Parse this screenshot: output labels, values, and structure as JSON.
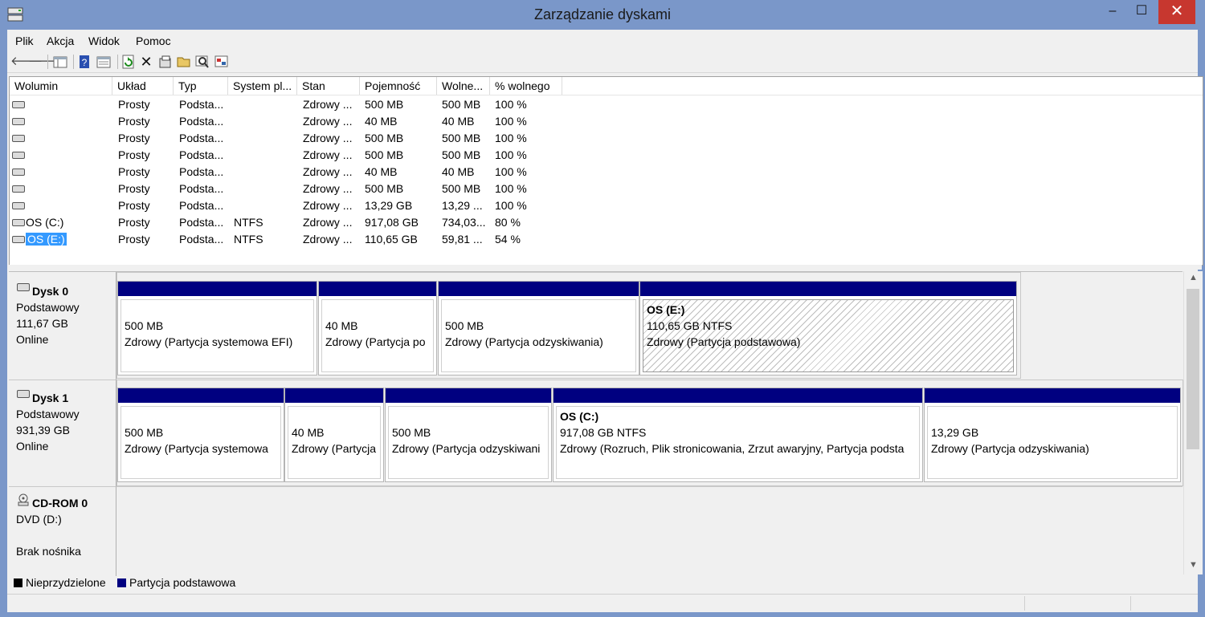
{
  "window": {
    "title": "Zarządzanie dyskami",
    "close_glyph": "✕",
    "max_glyph": "☐",
    "min_glyph": "–"
  },
  "menu": [
    "Plik",
    "Akcja",
    "Widok",
    "Pomoc"
  ],
  "toolbar": [
    "back-icon",
    "forward-icon",
    "console-tree-icon",
    "help-icon",
    "properties-icon",
    "refresh-icon",
    "delete-icon",
    "edit-icon",
    "open-icon",
    "search-icon",
    "settings-icon"
  ],
  "volume_table": {
    "columns": [
      "Wolumin",
      "Układ",
      "Typ",
      "System pl...",
      "Stan",
      "Pojemność",
      "Wolne...",
      "% wolnego"
    ],
    "rows": [
      [
        "",
        "Prosty",
        "Podsta...",
        "",
        "Zdrowy ...",
        "500 MB",
        "500 MB",
        "100 %"
      ],
      [
        "",
        "Prosty",
        "Podsta...",
        "",
        "Zdrowy ...",
        "40 MB",
        "40 MB",
        "100 %"
      ],
      [
        "",
        "Prosty",
        "Podsta...",
        "",
        "Zdrowy ...",
        "500 MB",
        "500 MB",
        "100 %"
      ],
      [
        "",
        "Prosty",
        "Podsta...",
        "",
        "Zdrowy ...",
        "500 MB",
        "500 MB",
        "100 %"
      ],
      [
        "",
        "Prosty",
        "Podsta...",
        "",
        "Zdrowy ...",
        "40 MB",
        "40 MB",
        "100 %"
      ],
      [
        "",
        "Prosty",
        "Podsta...",
        "",
        "Zdrowy ...",
        "500 MB",
        "500 MB",
        "100 %"
      ],
      [
        "",
        "Prosty",
        "Podsta...",
        "",
        "Zdrowy ...",
        "13,29 GB",
        "13,29 ...",
        "100 %"
      ],
      [
        "OS (C:)",
        "Prosty",
        "Podsta...",
        "NTFS",
        "Zdrowy ...",
        "917,08 GB",
        "734,03...",
        "80 %"
      ],
      [
        "OS (E:)",
        "Prosty",
        "Podsta...",
        "NTFS",
        "Zdrowy ...",
        "110,65 GB",
        "59,81 ...",
        "54 %"
      ]
    ],
    "selected_row": 8
  },
  "disks": [
    {
      "name": "Dysk 0",
      "type": "Podstawowy",
      "size": "111,67 GB",
      "status": "Online",
      "partitions": [
        {
          "label": "",
          "size": "500 MB",
          "status": "Zdrowy (Partycja systemowa EFI)"
        },
        {
          "label": "",
          "size": "40 MB",
          "status": "Zdrowy (Partycja po"
        },
        {
          "label": "",
          "size": "500 MB",
          "status": "Zdrowy (Partycja odzyskiwania)"
        },
        {
          "label": "OS  (E:)",
          "size": "110,65 GB NTFS",
          "status": "Zdrowy (Partycja podstawowa)"
        }
      ]
    },
    {
      "name": "Dysk 1",
      "type": "Podstawowy",
      "size": "931,39 GB",
      "status": "Online",
      "partitions": [
        {
          "label": "",
          "size": "500 MB",
          "status": "Zdrowy (Partycja systemowa"
        },
        {
          "label": "",
          "size": "40 MB",
          "status": "Zdrowy (Partycja"
        },
        {
          "label": "",
          "size": "500 MB",
          "status": "Zdrowy (Partycja odzyskiwani"
        },
        {
          "label": "OS  (C:)",
          "size": "917,08 GB NTFS",
          "status": "Zdrowy (Rozruch, Plik stronicowania, Zrzut awaryjny, Partycja podsta"
        },
        {
          "label": "",
          "size": "13,29 GB",
          "status": "Zdrowy (Partycja odzyskiwania)"
        }
      ]
    }
  ],
  "cdrom": {
    "name": "CD-ROM 0",
    "drive": "DVD (D:)",
    "media": "Brak nośnika"
  },
  "legend": [
    {
      "label": "Nieprzydzielone",
      "color": "#000000"
    },
    {
      "label": "Partycja podstawowa",
      "color": "#000080"
    }
  ]
}
